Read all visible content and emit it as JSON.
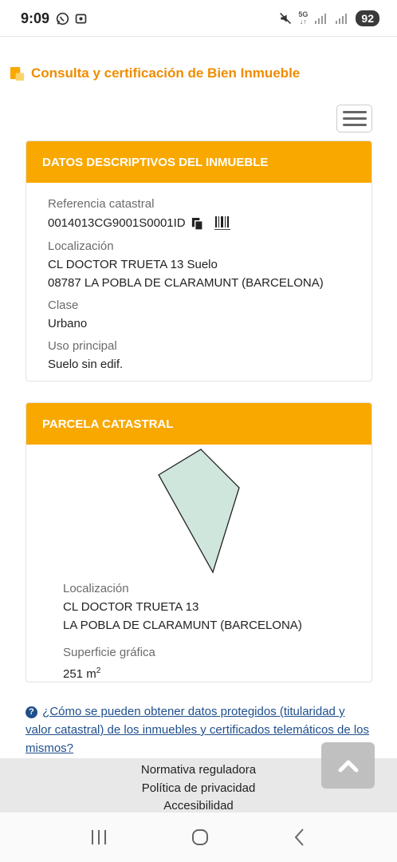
{
  "status": {
    "time": "9:09",
    "network": "5G",
    "battery": "92"
  },
  "page": {
    "title": "Consulta y certificación de Bien Inmueble"
  },
  "datos": {
    "header": "DATOS DESCRIPTIVOS DEL INMUEBLE",
    "ref_label": "Referencia catastral",
    "ref_value": "0014013CG9001S0001ID",
    "loc_label": "Localización",
    "loc_line1": "CL DOCTOR TRUETA 13 Suelo",
    "loc_line2": "08787 LA POBLA DE CLARAMUNT (BARCELONA)",
    "clase_label": "Clase",
    "clase_value": "Urbano",
    "uso_label": "Uso principal",
    "uso_value": "Suelo sin edif."
  },
  "parcela": {
    "header": "PARCELA CATASTRAL",
    "loc_label": "Localización",
    "loc_line1": "CL DOCTOR TRUETA 13",
    "loc_line2": "LA POBLA DE CLARAMUNT (BARCELONA)",
    "sup_label": "Superficie gráfica",
    "sup_value": "251 m",
    "sup_unit_exp": "2",
    "fill_color": "#cfe6dc"
  },
  "info": {
    "link_text": "¿Cómo se pueden obtener datos protegidos (titularidad y valor catastral) de los inmuebles y certificados telemáticos de los mismos?"
  },
  "footer": {
    "links": [
      "Normativa reguladora",
      "Política de privacidad",
      "Accesibilidad"
    ]
  },
  "colors": {
    "accent": "#f9a800",
    "title": "#f08c00",
    "link": "#1f4f8c"
  }
}
